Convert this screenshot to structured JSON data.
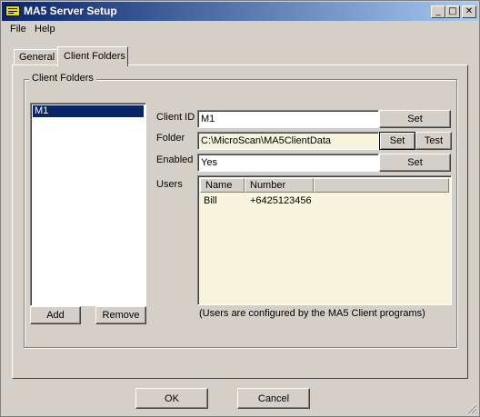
{
  "window": {
    "title": "MA5 Server Setup",
    "minimize_glyph": "_",
    "maximize_glyph": "□",
    "close_glyph": "✕"
  },
  "menu": {
    "items": [
      "File",
      "Help"
    ]
  },
  "tabs": [
    {
      "label": "General",
      "active": false
    },
    {
      "label": "Client Folders",
      "active": true
    }
  ],
  "client_folders": {
    "group_title": "Client Folders",
    "list": {
      "items": [
        "M1"
      ],
      "selected": "M1"
    },
    "add_label": "Add",
    "remove_label": "Remove"
  },
  "details": {
    "client_id": {
      "label": "Client ID",
      "value": "M1",
      "set_label": "Set"
    },
    "folder": {
      "label": "Folder",
      "value": "C:\\MicroScan\\MA5ClientData",
      "set_label": "Set",
      "test_label": "Test"
    },
    "enabled": {
      "label": "Enabled",
      "value": "Yes",
      "set_label": "Set"
    },
    "users": {
      "label": "Users",
      "columns": [
        "Name",
        "Number"
      ],
      "rows": [
        {
          "name": "Bill",
          "number": "+6425123456"
        }
      ],
      "note": "(Users are configured by the MA5 Client programs)"
    }
  },
  "footer": {
    "ok_label": "OK",
    "cancel_label": "Cancel"
  },
  "colors": {
    "title_start": "#0a246a",
    "title_end": "#a6caf0",
    "face": "#d4d0c8",
    "selection": "#0a246a",
    "readonly_field": "#f6f4dc"
  }
}
